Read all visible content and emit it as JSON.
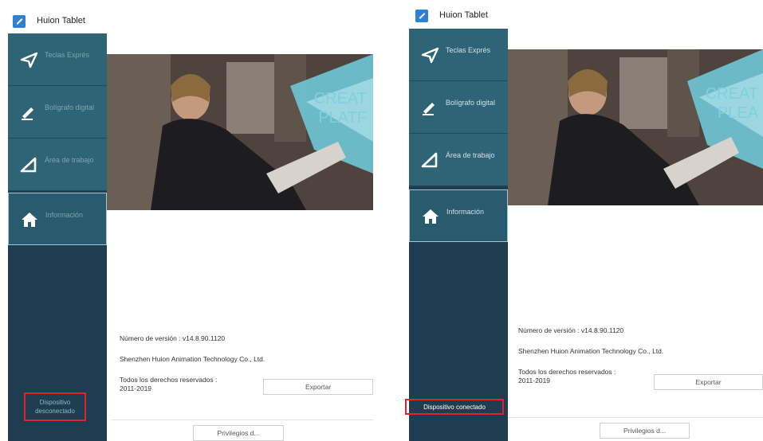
{
  "left_window": {
    "title": "Huion Tablet",
    "nav": [
      {
        "label": "Teclas Exprés",
        "icon": "send-arrow-icon",
        "active": false
      },
      {
        "label": "Bolígrafo digital",
        "icon": "pen-icon",
        "active": false
      },
      {
        "label": "Área de trabajo",
        "icon": "work-area-icon",
        "active": false
      },
      {
        "label": "Información",
        "icon": "home-icon",
        "active": true
      }
    ],
    "banner": {
      "text": "CREAT PLATF"
    },
    "status": "Dispositivo desconectado",
    "info": {
      "version": "Número de versión : v14.8.90.1120",
      "company": "Shenzhen Huion Animation Technology Co., Ltd.",
      "rights_line1": "Todos los derechos reservados :",
      "rights_line2": "2011-2019"
    },
    "buttons": {
      "export": "Exportar",
      "privileges": "Privilegios d..."
    }
  },
  "right_window": {
    "title": "Huion Tablet",
    "nav": [
      {
        "label": "Teclas Exprés",
        "icon": "send-arrow-icon",
        "active": false
      },
      {
        "label": "Bolígrafo digital",
        "icon": "pen-icon",
        "active": false
      },
      {
        "label": "Área de trabajo",
        "icon": "work-area-icon",
        "active": false
      },
      {
        "label": "Información",
        "icon": "home-icon",
        "active": true
      }
    ],
    "banner": {
      "text": "CREAT PLEA"
    },
    "status": "Dispositivo conectado",
    "info": {
      "version": "Número de versión : v14.8.90.1120",
      "company": "Shenzhen Huion Animation Technology Co., Ltd.",
      "rights_line1": "Todos los derechos reservados :",
      "rights_line2": "2011-2019"
    },
    "buttons": {
      "export": "Exportar",
      "privileges": "Privilegios d..."
    }
  },
  "colors": {
    "sidebar_dark": "#1e3d50",
    "nav_item": "#2e6475",
    "status_highlight": "#e0232b",
    "banner_accent": "#6fc6d6"
  }
}
